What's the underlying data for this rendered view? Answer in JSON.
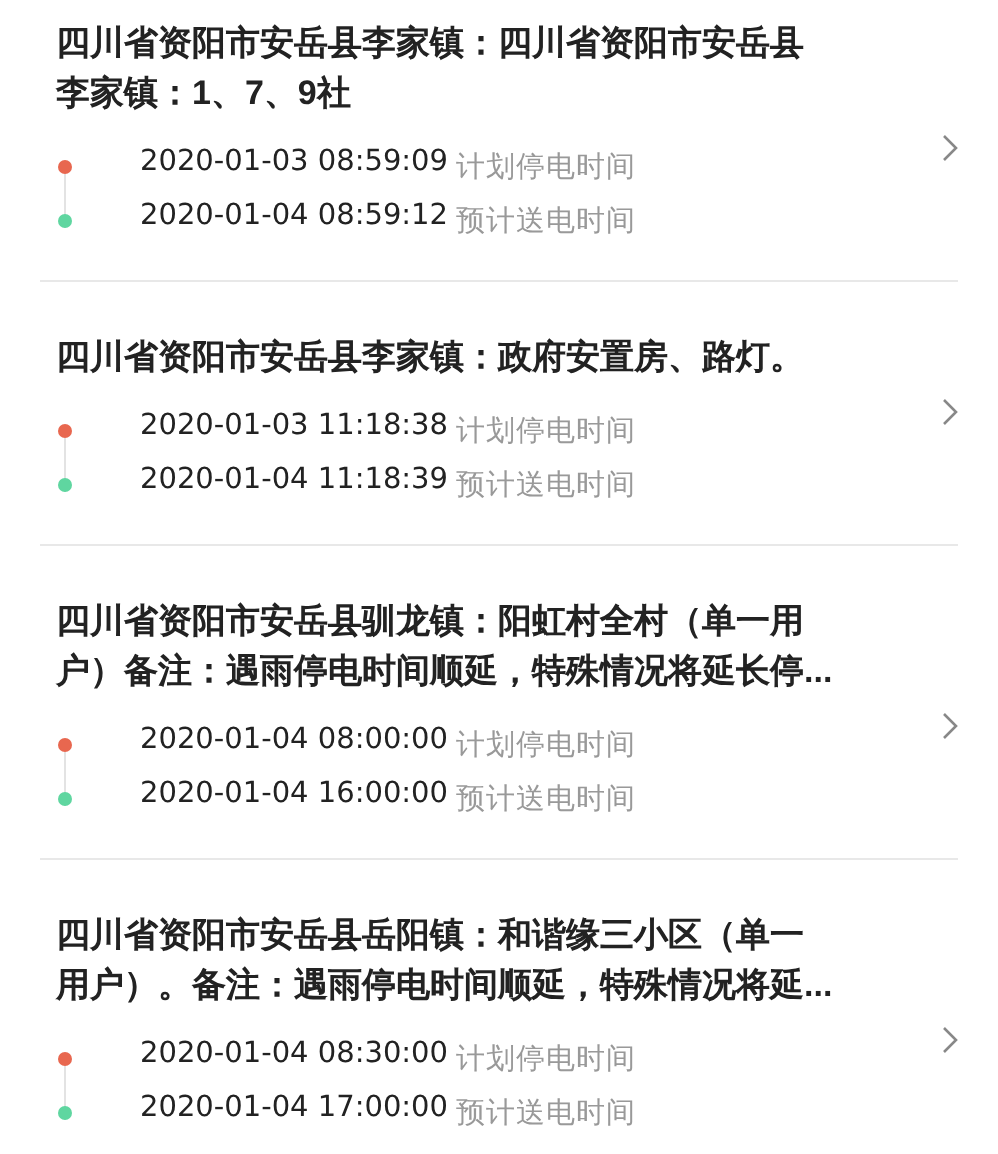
{
  "outages": [
    {
      "title": "四川省资阳市安岳县李家镇：四川省资阳市安岳县李家镇：1、7、9社",
      "times": [
        {
          "time": "2020-01-03 08:59:09",
          "label": "计划停电时间",
          "color": "#e8674f"
        },
        {
          "time": "2020-01-04 08:59:12",
          "label": "预计送电时间",
          "color": "#5fd6a0"
        }
      ]
    },
    {
      "title": "四川省资阳市安岳县李家镇：政府安置房、路灯。",
      "times": [
        {
          "time": "2020-01-03 11:18:38",
          "label": "计划停电时间",
          "color": "#e8674f"
        },
        {
          "time": "2020-01-04 11:18:39",
          "label": "预计送电时间",
          "color": "#5fd6a0"
        }
      ]
    },
    {
      "title": "四川省资阳市安岳县驯龙镇：阳虹村全村（单一用户）备注：遇雨停电时间顺延，特殊情况将延长停...",
      "times": [
        {
          "time": "2020-01-04 08:00:00",
          "label": "计划停电时间",
          "color": "#e8674f"
        },
        {
          "time": "2020-01-04 16:00:00",
          "label": "预计送电时间",
          "color": "#5fd6a0"
        }
      ]
    },
    {
      "title": "四川省资阳市安岳县岳阳镇：和谐缘三小区（单一用户）。备注：遇雨停电时间顺延，特殊情况将延...",
      "times": [
        {
          "time": "2020-01-04 08:30:00",
          "label": "计划停电时间",
          "color": "#e8674f"
        },
        {
          "time": "2020-01-04 17:00:00",
          "label": "预计送电时间",
          "color": "#5fd6a0"
        }
      ]
    }
  ]
}
